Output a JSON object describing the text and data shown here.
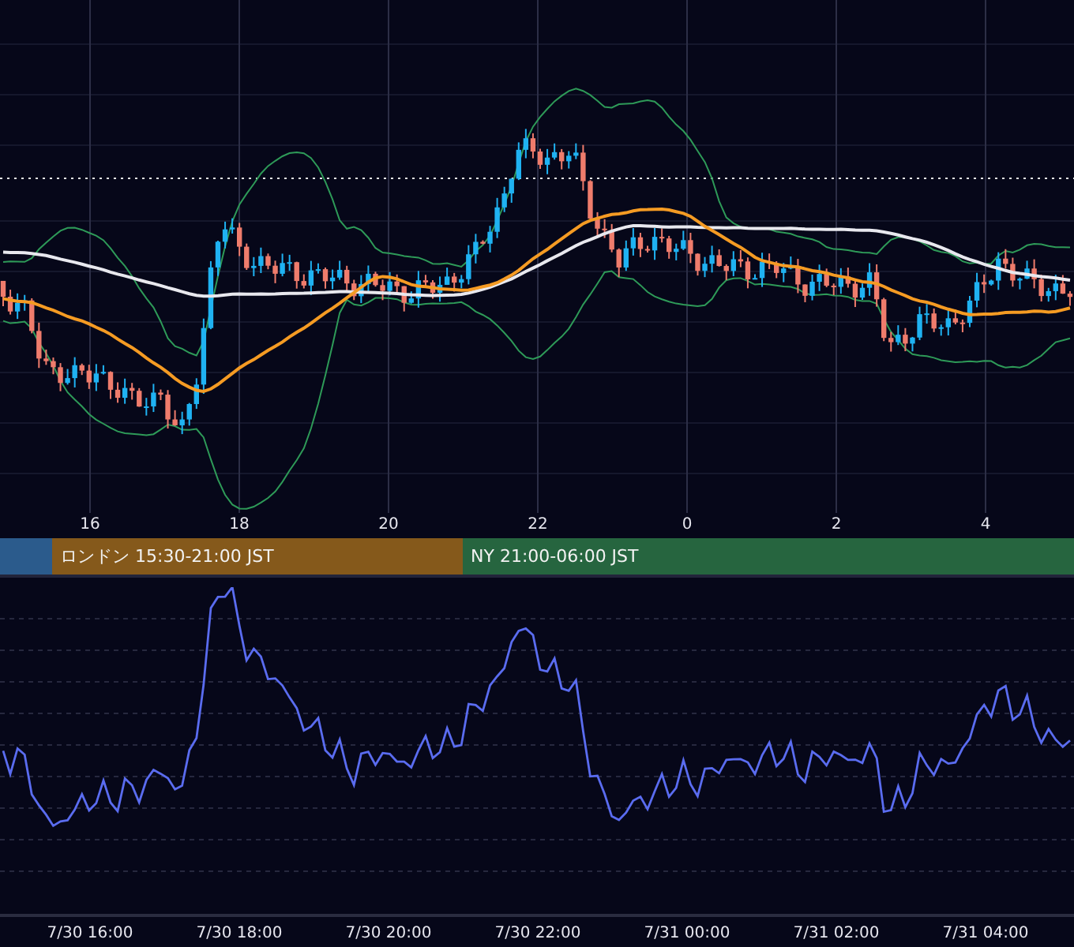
{
  "price_chart": {
    "hour_labels": [
      "16",
      "18",
      "20",
      "22",
      "0",
      "2",
      "4"
    ]
  },
  "sessions": [
    {
      "color": "#2b5b8c"
    },
    {
      "label": "ロンドン 15:30-21:00 JST",
      "color": "#85591b"
    },
    {
      "label": "NY 21:00-06:00 JST",
      "color": "#26653f"
    }
  ],
  "oscillator": {
    "time_labels": [
      "7/30 16:00",
      "7/30 18:00",
      "7/30 20:00",
      "7/30 22:00",
      "7/31 00:00",
      "7/31 02:00",
      "7/31 04:00"
    ]
  }
}
